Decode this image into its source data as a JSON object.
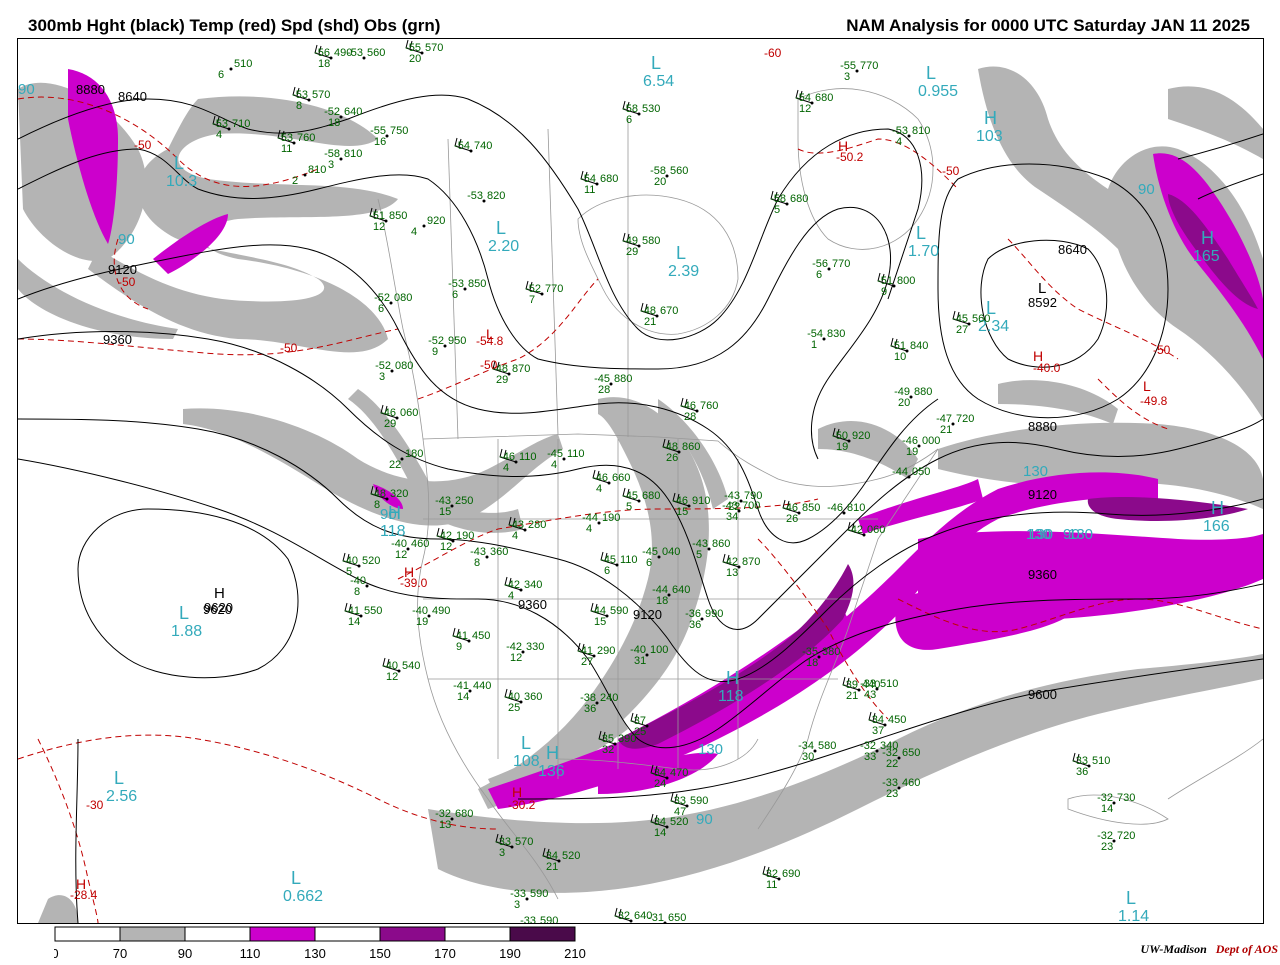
{
  "header": {
    "title_left": "300mb Hght (black) Temp (red) Spd (shd) Obs (grn)",
    "title_right": "NAM Analysis for 0000 UTC Saturday  JAN 11 2025"
  },
  "credit": {
    "org": "UW-Madison",
    "dept": "Dept of AOS"
  },
  "colors": {
    "shade_70": "#b4b4b4",
    "shade_110": "#cc00cc",
    "shade_150": "#8b0a8b",
    "shade_190": "#4a0a4a",
    "height": "#000000",
    "temp": "#c00000",
    "obs": "#006400",
    "speed_label": "#33aabb",
    "border": "#999999"
  },
  "legend": {
    "ticks": [
      "0",
      "70",
      "90",
      "110",
      "130",
      "150",
      "170",
      "190",
      "210"
    ],
    "bins": [
      "#ffffff",
      "#b4b4b4",
      "#ffffff",
      "#cc00cc",
      "#ffffff",
      "#8b0a8b",
      "#ffffff",
      "#4a0a4a"
    ]
  },
  "height_labels": [
    "8880",
    "8640",
    "9120",
    "9360",
    "8640",
    "8880",
    "9120",
    "9360",
    "9600",
    "9360",
    "9120",
    "9620"
  ],
  "height_centers": [
    {
      "mark": "H",
      "label": "9620"
    },
    {
      "mark": "L",
      "label": "8592"
    }
  ],
  "temp_labels": [
    "-60",
    "-50",
    "-50",
    "-50",
    "-50",
    "-50",
    "-50",
    "-30",
    "-40.0",
    "-49.8",
    "-50.2",
    "-54.8",
    "-39.0",
    "-30.2",
    "-28.4"
  ],
  "temp_centers": [
    {
      "mark": "H",
      "label": "-50.2"
    },
    {
      "mark": "H",
      "label": "-40.0"
    },
    {
      "mark": "L",
      "label": "-49.8"
    },
    {
      "mark": "L",
      "label": "-54.8"
    },
    {
      "mark": "H",
      "label": "-39.0"
    },
    {
      "mark": "H",
      "label": "-30.2"
    },
    {
      "mark": "H",
      "label": "-28.4"
    }
  ],
  "speed_labels": [
    "90",
    "90",
    "90",
    "90",
    "130",
    "130",
    "130",
    "130",
    "90",
    "90",
    "130"
  ],
  "speed_centers": [
    {
      "mark": "L",
      "label": "10.3"
    },
    {
      "mark": "L",
      "label": "2.20"
    },
    {
      "mark": "L",
      "label": "2.39"
    },
    {
      "mark": "L",
      "label": "1.70"
    },
    {
      "mark": "L",
      "label": "0.955"
    },
    {
      "mark": "H",
      "label": "103"
    },
    {
      "mark": "L",
      "label": "2.34"
    },
    {
      "mark": "H",
      "label": "165"
    },
    {
      "mark": "H",
      "label": "166"
    },
    {
      "mark": "H",
      "label": "136"
    },
    {
      "mark": "H",
      "label": "118"
    },
    {
      "mark": "L",
      "label": "1.88"
    },
    {
      "mark": "L",
      "label": "2.56"
    },
    {
      "mark": "L",
      "label": "0.662"
    },
    {
      "mark": "L",
      "label": "1.14"
    },
    {
      "mark": "L",
      "label": "6.54"
    },
    {
      "mark": "H",
      "label": "118"
    },
    {
      "mark": "L",
      "label": "108"
    }
  ],
  "observations": [
    {
      "t": "-56",
      "h": "490",
      "d": "18"
    },
    {
      "t": "-53",
      "h": "560",
      "d": ""
    },
    {
      "t": "-55",
      "h": "570",
      "d": "20"
    },
    {
      "t": "",
      "h": "510",
      "d": "6"
    },
    {
      "t": "-53",
      "h": "570",
      "d": "8"
    },
    {
      "t": "-52",
      "h": "640",
      "d": "18"
    },
    {
      "t": "-53",
      "h": "710",
      "d": "4"
    },
    {
      "t": "-55",
      "h": "750",
      "d": "16"
    },
    {
      "t": "-53",
      "h": "760",
      "d": "11"
    },
    {
      "t": "-58",
      "h": "810",
      "d": "3"
    },
    {
      "t": "-54",
      "h": "740",
      "d": ""
    },
    {
      "t": "",
      "h": "810",
      "d": "2"
    },
    {
      "t": "-58",
      "h": "530",
      "d": "6"
    },
    {
      "t": "-58",
      "h": "560",
      "d": "20"
    },
    {
      "t": "-54",
      "h": "680",
      "d": "11"
    },
    {
      "t": "-53",
      "h": "820",
      "d": ""
    },
    {
      "t": "-58",
      "h": "680",
      "d": "5"
    },
    {
      "t": "-55",
      "h": "770",
      "d": "3"
    },
    {
      "t": "-54",
      "h": "680",
      "d": "12"
    },
    {
      "t": "-53",
      "h": "810",
      "d": "4"
    },
    {
      "t": "-51",
      "h": "850",
      "d": "12"
    },
    {
      "t": "",
      "h": "920",
      "d": "4"
    },
    {
      "t": "-49",
      "h": "580",
      "d": "29"
    },
    {
      "t": "-53",
      "h": "850",
      "d": "6"
    },
    {
      "t": "-52",
      "h": "770",
      "d": "7"
    },
    {
      "t": "-56",
      "h": "770",
      "d": "6"
    },
    {
      "t": "-51",
      "h": "800",
      "d": "9"
    },
    {
      "t": "-52",
      "h": "080",
      "d": "6"
    },
    {
      "t": "-48",
      "h": "670",
      "d": "21"
    },
    {
      "t": "-54",
      "h": "830",
      "d": "1"
    },
    {
      "t": "-45",
      "h": "560",
      "d": "27"
    },
    {
      "t": "-52",
      "h": "950",
      "d": "9"
    },
    {
      "t": "-51",
      "h": "840",
      "d": "10"
    },
    {
      "t": "-52",
      "h": "080",
      "d": "3"
    },
    {
      "t": "-48",
      "h": "870",
      "d": "29"
    },
    {
      "t": "-45",
      "h": "880",
      "d": "28"
    },
    {
      "t": "-46",
      "h": "760",
      "d": "28"
    },
    {
      "t": "-49",
      "h": "880",
      "d": "20"
    },
    {
      "t": "-46",
      "h": "060",
      "d": "29"
    },
    {
      "t": "-47",
      "h": "720",
      "d": "21"
    },
    {
      "t": "-50",
      "h": "920",
      "d": "19"
    },
    {
      "t": "-46",
      "h": "000",
      "d": "19"
    },
    {
      "t": "-46",
      "h": "110",
      "d": "4"
    },
    {
      "t": "-45",
      "h": "110",
      "d": "4"
    },
    {
      "t": "-48",
      "h": "860",
      "d": "26"
    },
    {
      "t": "",
      "h": "180",
      "d": "22"
    },
    {
      "t": "-46",
      "h": "660",
      "d": "4"
    },
    {
      "t": "-44",
      "h": "050",
      "d": ""
    },
    {
      "t": "-48",
      "h": "320",
      "d": "8"
    },
    {
      "t": "-43",
      "h": "250",
      "d": "15"
    },
    {
      "t": "-45",
      "h": "680",
      "d": "5"
    },
    {
      "t": "-43",
      "h": "790",
      "d": "22"
    },
    {
      "t": "-46",
      "h": "910",
      "d": "15"
    },
    {
      "t": "-43",
      "h": "700",
      "d": "34"
    },
    {
      "t": "-46",
      "h": "850",
      "d": "26"
    },
    {
      "t": "-46",
      "h": "810",
      "d": ""
    },
    {
      "t": "-43",
      "h": "280",
      "d": "4"
    },
    {
      "t": "-44",
      "h": "190",
      "d": "4"
    },
    {
      "t": "-42",
      "h": "060",
      "d": ""
    },
    {
      "t": "-43",
      "h": "860",
      "d": "5"
    },
    {
      "t": "-40",
      "h": "520",
      "d": "5"
    },
    {
      "t": "-40",
      "h": "460",
      "d": "12"
    },
    {
      "t": "-42",
      "h": "190",
      "d": "12"
    },
    {
      "t": "-43",
      "h": "360",
      "d": "8"
    },
    {
      "t": "-45",
      "h": "110",
      "d": "6"
    },
    {
      "t": "-45",
      "h": "040",
      "d": "6"
    },
    {
      "t": "-42",
      "h": "870",
      "d": "13"
    },
    {
      "t": "-40",
      "h": "",
      "d": "8"
    },
    {
      "t": "-42",
      "h": "340",
      "d": "4"
    },
    {
      "t": "-44",
      "h": "640",
      "d": "18"
    },
    {
      "t": "-41",
      "h": "550",
      "d": "14"
    },
    {
      "t": "-40",
      "h": "490",
      "d": "19"
    },
    {
      "t": "-44",
      "h": "590",
      "d": "15"
    },
    {
      "t": "-36",
      "h": "990",
      "d": "36"
    },
    {
      "t": "-41",
      "h": "450",
      "d": "9"
    },
    {
      "t": "-42",
      "h": "330",
      "d": "12"
    },
    {
      "t": "-41",
      "h": "290",
      "d": "27"
    },
    {
      "t": "-40",
      "h": "100",
      "d": "31"
    },
    {
      "t": "-40",
      "h": "540",
      "d": "12"
    },
    {
      "t": "-35",
      "h": "380",
      "d": "18"
    },
    {
      "t": "-39",
      "h": "440",
      "d": "21"
    },
    {
      "t": "-41",
      "h": "440",
      "d": "14"
    },
    {
      "t": "-40",
      "h": "360",
      "d": "25"
    },
    {
      "t": "-38",
      "h": "240",
      "d": "36"
    },
    {
      "t": "-37",
      "h": "",
      "d": "25"
    },
    {
      "t": "-33",
      "h": "510",
      "d": "43"
    },
    {
      "t": "-34",
      "h": "450",
      "d": "37"
    },
    {
      "t": "-34",
      "h": "580",
      "d": "30"
    },
    {
      "t": "-35",
      "h": "390",
      "d": "32"
    },
    {
      "t": "-32",
      "h": "340",
      "d": "33"
    },
    {
      "t": "-33",
      "h": "590",
      "d": "47"
    },
    {
      "t": "-32",
      "h": "650",
      "d": "22"
    },
    {
      "t": "-34",
      "h": "470",
      "d": "24"
    },
    {
      "t": "-33",
      "h": "460",
      "d": "23"
    },
    {
      "t": "-33",
      "h": "510",
      "d": "36"
    },
    {
      "t": "-32",
      "h": "680",
      "d": "13"
    },
    {
      "t": "-34",
      "h": "520",
      "d": "14"
    },
    {
      "t": "-32",
      "h": "730",
      "d": "14"
    },
    {
      "t": "-33",
      "h": "570",
      "d": "3"
    },
    {
      "t": "-32",
      "h": "720",
      "d": "23"
    },
    {
      "t": "-34",
      "h": "520",
      "d": "21"
    },
    {
      "t": "-33",
      "h": "590",
      "d": "3"
    },
    {
      "t": "-32",
      "h": "690",
      "d": "11"
    },
    {
      "t": "-33",
      "h": "590",
      "d": ""
    },
    {
      "t": "-32",
      "h": "640",
      "d": ""
    },
    {
      "t": "-31",
      "h": "650",
      "d": ""
    }
  ]
}
